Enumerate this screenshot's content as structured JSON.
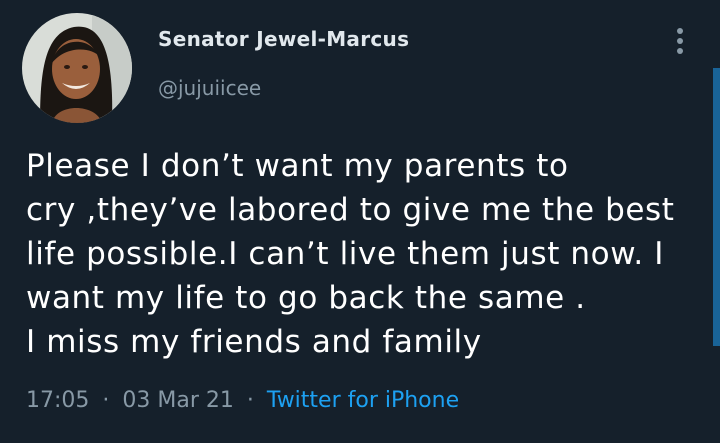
{
  "author": {
    "display_name": "Senator Jewel-Marcus",
    "handle": "@jujuiicee"
  },
  "tweet": {
    "lines": [
      "Please I don’t want my parents to",
      "cry ,they’ve labored to give me the best",
      "life possible.I can’t live them just now. I",
      "want my life to go back the same .",
      "I miss my friends and family"
    ]
  },
  "meta": {
    "time": "17:05",
    "separator": "·",
    "date": "03 Mar 21",
    "source": "Twitter for iPhone"
  },
  "icons": {
    "more": "more-vertical-icon"
  },
  "colors": {
    "background": "#15202b",
    "text": "#ffffff",
    "secondary": "#8899a6",
    "accent": "#1da1f2"
  }
}
